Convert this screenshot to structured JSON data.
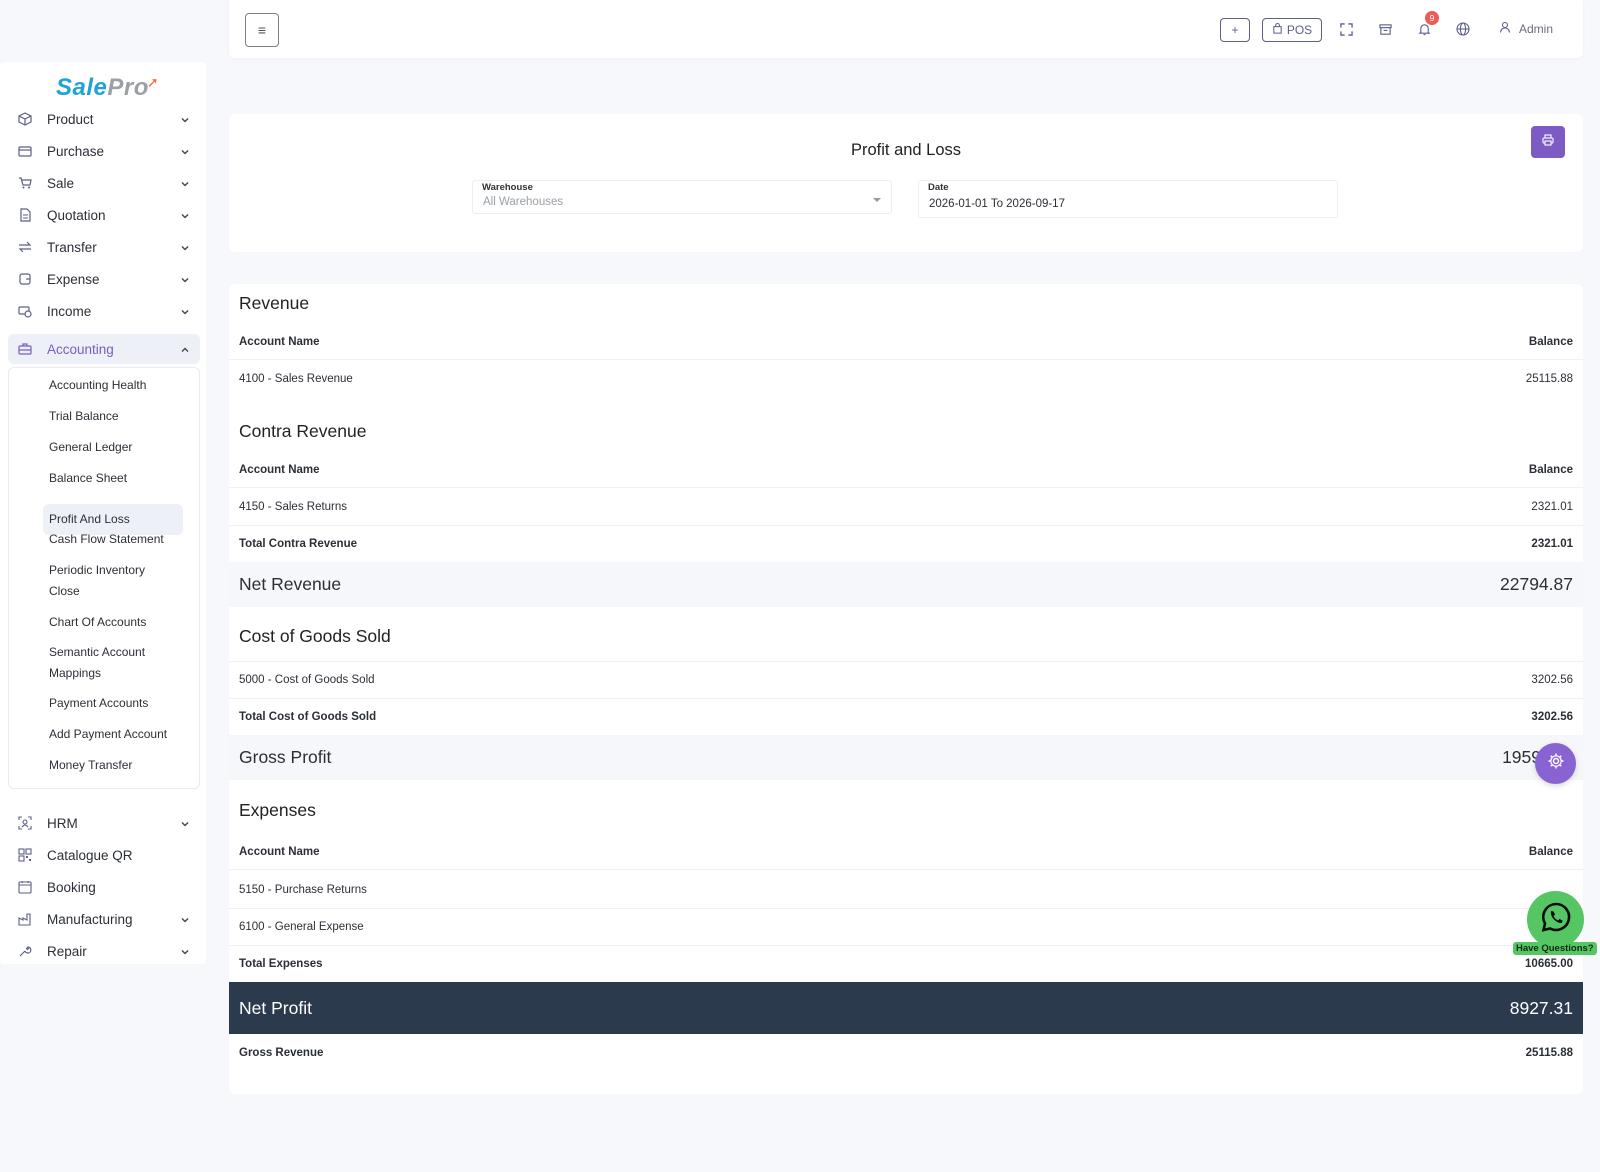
{
  "app": {
    "logo_main": "Sale",
    "logo_accent": "Pro"
  },
  "sidebar": {
    "items": [
      {
        "label": "Product",
        "icon": "box-icon"
      },
      {
        "label": "Purchase",
        "icon": "card-icon"
      },
      {
        "label": "Sale",
        "icon": "cart-icon"
      },
      {
        "label": "Quotation",
        "icon": "document-icon"
      },
      {
        "label": "Transfer",
        "icon": "transfer-icon"
      },
      {
        "label": "Expense",
        "icon": "wallet-icon"
      },
      {
        "label": "Income",
        "icon": "money-icon"
      },
      {
        "label": "Accounting",
        "icon": "briefcase-icon"
      }
    ],
    "accounting_sub": [
      "Accounting Health",
      "Trial Balance",
      "General Ledger",
      "Balance Sheet",
      "Profit And Loss",
      "Cash Flow Statement",
      "Periodic Inventory",
      "Close",
      "Chart Of Accounts",
      "Semantic Account",
      "Mappings",
      "Payment Accounts",
      "Add Payment Account",
      "Money Transfer"
    ],
    "lower_items": [
      {
        "label": "HRM"
      },
      {
        "label": "Catalogue QR"
      },
      {
        "label": "Booking"
      },
      {
        "label": "Manufacturing"
      },
      {
        "label": "Repair"
      }
    ]
  },
  "topbar": {
    "pos_label": "POS",
    "notification_count": "9",
    "user_name": "Admin"
  },
  "filters": {
    "title": "Profit and Loss",
    "warehouse_label": "Warehouse",
    "warehouse_value": "All Warehouses",
    "date_label": "Date",
    "date_value": "2026-01-01 To 2026-09-17"
  },
  "report": {
    "revenue_title": "Revenue",
    "col_account": "Account Name",
    "col_balance": "Balance",
    "revenue_row": {
      "name": "4100 - Sales Revenue",
      "value": "25115.88"
    },
    "contra_title": "Contra Revenue",
    "contra_row": {
      "name": "4150 - Sales Returns",
      "value": "2321.01"
    },
    "contra_total": {
      "name": "Total Contra Revenue",
      "value": "2321.01"
    },
    "net_revenue": {
      "name": "Net Revenue",
      "value": "22794.87"
    },
    "cogs_title": "Cost of Goods Sold",
    "cogs_row": {
      "name": "5000 - Cost of Goods Sold",
      "value": "3202.56"
    },
    "cogs_total": {
      "name": "Total Cost of Goods Sold",
      "value": "3202.56"
    },
    "gross_profit": {
      "name": "Gross Profit",
      "value": "1959"
    },
    "expenses_title": "Expenses",
    "expense_rows": [
      {
        "name": "5150 - Purchase Returns"
      },
      {
        "name": "6100 - General Expense"
      }
    ],
    "expenses_total": {
      "name": "Total Expenses",
      "value": "10665.00"
    },
    "net_profit": {
      "name": "Net Profit",
      "value": "8927.31"
    },
    "gross_revenue": {
      "name": "Gross Revenue",
      "value": "25115.88"
    }
  },
  "floating": {
    "help_label": "Have Questions?"
  },
  "colors": {
    "accent": "#7c5cc4",
    "net_profit_bg": "#2c3a4d",
    "whatsapp": "#56c563"
  }
}
